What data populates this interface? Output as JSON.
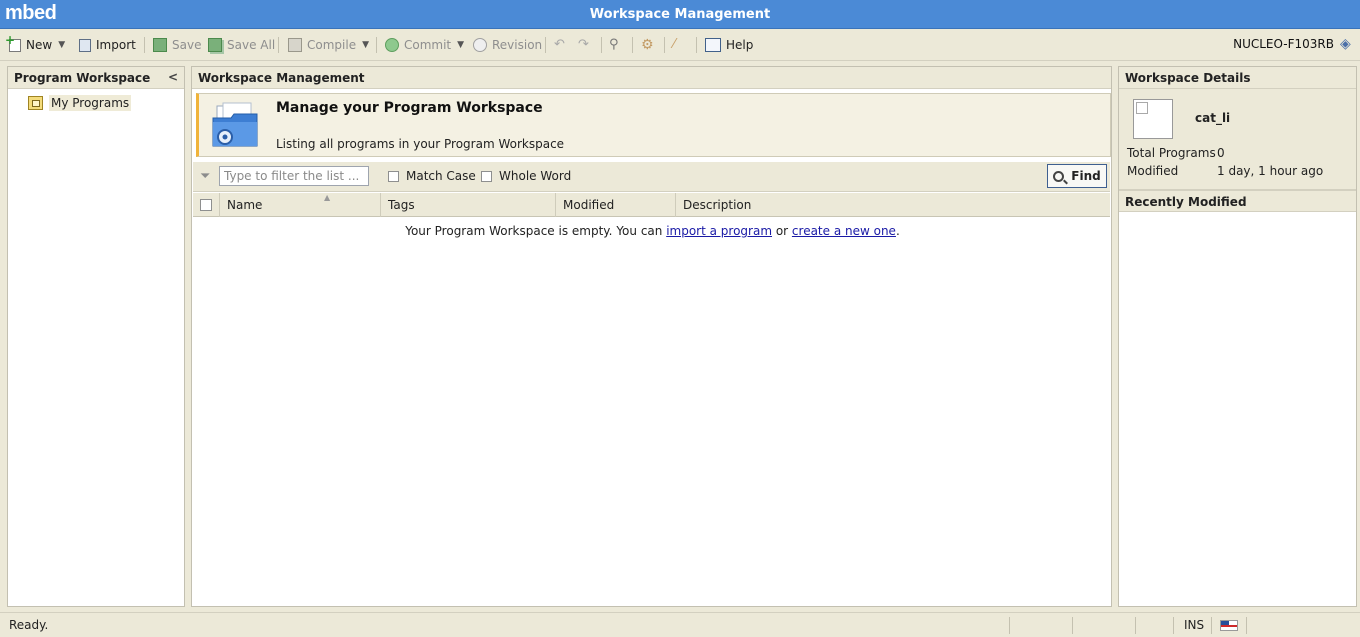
{
  "app": {
    "logo": "mbed",
    "window_title": "Workspace Management"
  },
  "toolbar": {
    "new": "New",
    "import": "Import",
    "save": "Save",
    "save_all": "Save All",
    "compile": "Compile",
    "commit": "Commit",
    "revision": "Revision",
    "help": "Help",
    "target": "NUCLEO-F103RB"
  },
  "left_panel": {
    "title": "Program Workspace",
    "tree": [
      {
        "label": "My Programs"
      }
    ]
  },
  "center": {
    "title": "Workspace Management",
    "banner_title": "Manage your Program Workspace",
    "banner_subtitle": "Listing all programs in your Program Workspace",
    "filter_placeholder": "Type to filter the list ...",
    "match_case": "Match Case",
    "whole_word": "Whole Word",
    "find": "Find",
    "columns": [
      "Name",
      "Tags",
      "Modified",
      "Description"
    ],
    "empty_text_1": "Your Program Workspace is empty. You can ",
    "empty_link_import": "import a program",
    "empty_text_2": " or ",
    "empty_link_create": "create a new one",
    "empty_text_3": "."
  },
  "right_panel": {
    "title": "Workspace Details",
    "username": "cat_li",
    "total_programs_label": "Total Programs",
    "total_programs_value": "0",
    "modified_label": "Modified",
    "modified_value": "1 day, 1 hour ago",
    "recently_modified_title": "Recently Modified"
  },
  "status": {
    "text": "Ready.",
    "mode": "INS"
  },
  "colors": {
    "titlebar": "#4b8ad6",
    "chrome": "#ece9d8",
    "link": "#1a1aa6",
    "banner_accent": "#f0b33a"
  }
}
